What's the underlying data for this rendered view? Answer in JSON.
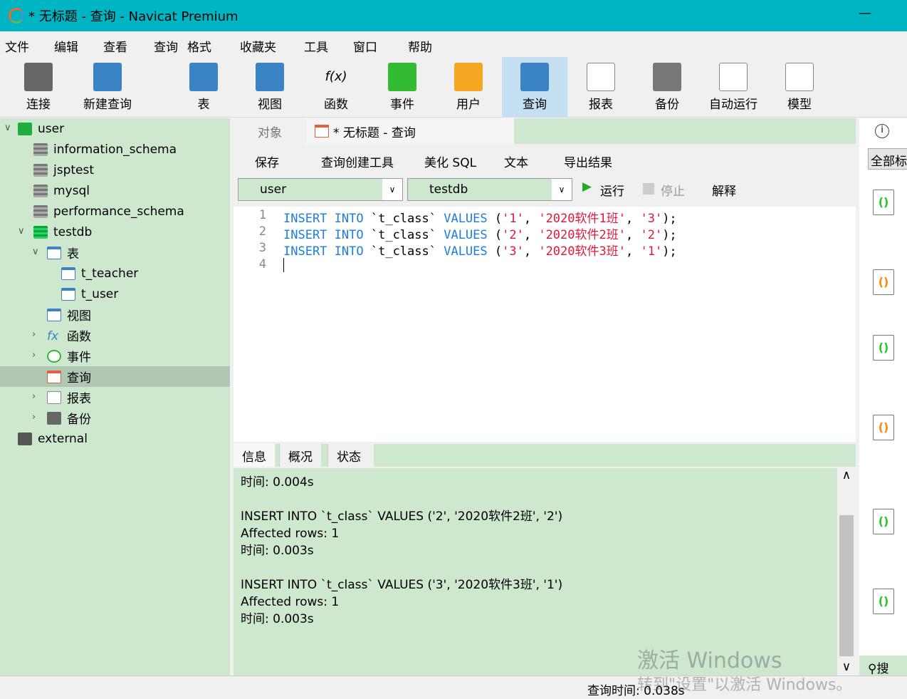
{
  "window": {
    "title": "* 无标题 - 查询 - Navicat Premium"
  },
  "menu": [
    "文件",
    "编辑",
    "查看",
    "查询",
    "格式",
    "收藏夹",
    "工具",
    "窗口",
    "帮助"
  ],
  "toolbar": [
    {
      "label": "连接",
      "icon": "plug-add-icon"
    },
    {
      "label": "新建查询",
      "icon": "new-query-icon"
    },
    {
      "label": "表",
      "icon": "table-icon"
    },
    {
      "label": "视图",
      "icon": "view-icon"
    },
    {
      "label": "函数",
      "icon": "function-icon"
    },
    {
      "label": "事件",
      "icon": "clock-icon"
    },
    {
      "label": "用户",
      "icon": "user-icon"
    },
    {
      "label": "查询",
      "icon": "query-icon",
      "active": true
    },
    {
      "label": "报表",
      "icon": "report-icon"
    },
    {
      "label": "备份",
      "icon": "backup-icon"
    },
    {
      "label": "自动运行",
      "icon": "schedule-icon"
    },
    {
      "label": "模型",
      "icon": "model-icon"
    }
  ],
  "tree": {
    "connection": "user",
    "databases": [
      "information_schema",
      "jsptest",
      "mysql",
      "performance_schema",
      "testdb"
    ],
    "testdb_children": {
      "tables_label": "表",
      "tables": [
        "t_teacher",
        "t_user"
      ],
      "views": "视图",
      "functions": "函数",
      "events": "事件",
      "queries": "查询",
      "reports": "报表",
      "backups": "备份"
    },
    "other": "external"
  },
  "tabs": {
    "objects": "对象",
    "query": "* 无标题 - 查询"
  },
  "editor_toolbar": {
    "save": "保存",
    "builder": "查询创建工具",
    "beautify": "美化 SQL",
    "text": "文本",
    "export": "导出结果",
    "run": "运行",
    "stop": "停止",
    "explain": "解释"
  },
  "selectors": {
    "connection": "user",
    "database": "testdb"
  },
  "code": [
    {
      "n": "1",
      "id": "1",
      "name": "2020软件1班",
      "v": "3"
    },
    {
      "n": "2",
      "id": "2",
      "name": "2020软件2班",
      "v": "2"
    },
    {
      "n": "3",
      "id": "3",
      "name": "2020软件3班",
      "v": "1"
    }
  ],
  "code_tokens": {
    "insert": "INSERT",
    "into": "INTO",
    "table": "`t_class`",
    "values": "VALUES",
    "line4": "4"
  },
  "result_tabs": [
    "信息",
    "概况",
    "状态"
  ],
  "messages": [
    "时间: 0.004s",
    "",
    "INSERT INTO `t_class` VALUES ('2', '2020软件2班', '2')",
    "Affected rows: 1",
    "时间: 0.003s",
    "",
    "INSERT INTO `t_class` VALUES ('3', '2020软件3班', '1')",
    "Affected rows: 1",
    "时间: 0.003s"
  ],
  "right_panel": {
    "filter": "全部标",
    "search": "搜索"
  },
  "status": {
    "query_time": "查询时间: 0.038s"
  },
  "watermark": {
    "line1": "激活 Windows",
    "line2": "转到\"设置\"以激活 Windows。"
  }
}
